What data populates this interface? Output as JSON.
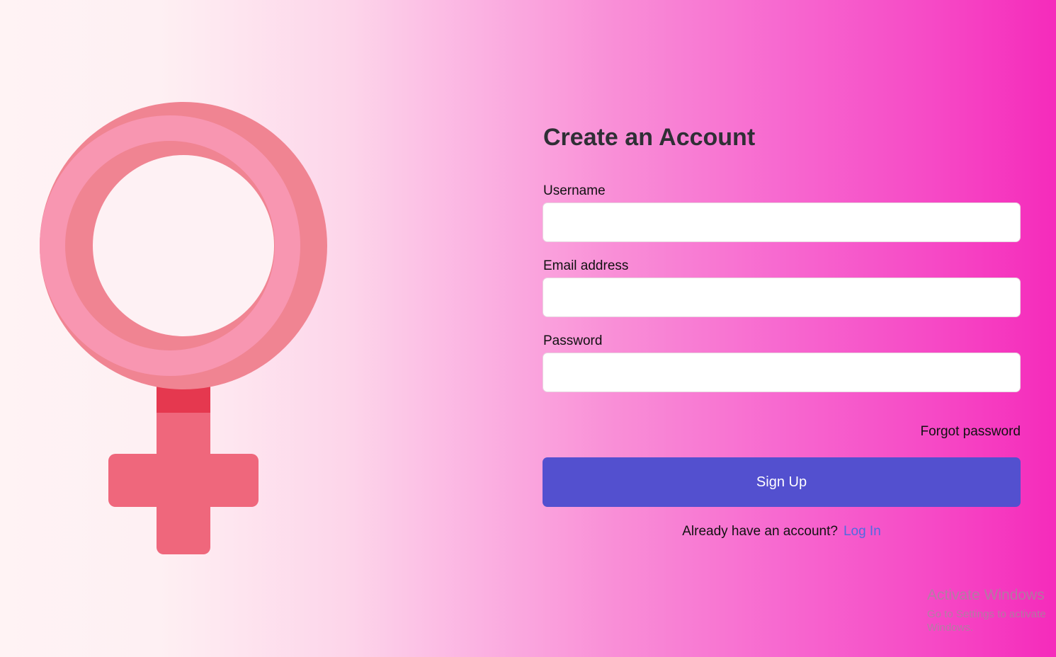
{
  "illustration": {
    "icon": "female-symbol-icon",
    "colors": {
      "ring_light": "#f896b1",
      "ring_dark": "#f08492",
      "stem": "#ef677c",
      "band": "#e5384f"
    }
  },
  "form": {
    "title": "Create an Account",
    "fields": [
      {
        "label": "Username",
        "value": "",
        "placeholder": ""
      },
      {
        "label": "Email address",
        "value": "",
        "placeholder": ""
      },
      {
        "label": "Password",
        "value": "",
        "placeholder": ""
      }
    ],
    "forgot_password": "Forgot password",
    "submit_label": "Sign Up",
    "already_text": "Already have an account?",
    "login_link": "Log In",
    "colors": {
      "button": "#5350cf",
      "link": "#4f6be0"
    }
  },
  "watermark": {
    "line1": "Activate Windows",
    "line2": "Go to Settings to activate Windows."
  }
}
